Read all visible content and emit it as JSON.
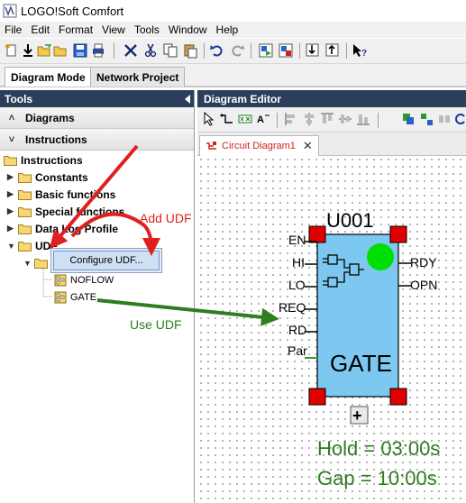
{
  "window": {
    "title": "LOGO!Soft Comfort",
    "app_icon": "logo-app-icon"
  },
  "menubar": {
    "items": [
      "File",
      "Edit",
      "Format",
      "View",
      "Tools",
      "Window",
      "Help"
    ]
  },
  "toolbar": {
    "icons": [
      "new-icon",
      "download-icon",
      "open-folder-icon",
      "open-file-icon",
      "save-icon",
      "print-icon",
      "cut-icon",
      "scissors-icon",
      "copy-icon",
      "paste-icon",
      "undo-icon",
      "redo-icon",
      "simulation-icon",
      "online-test-icon",
      "transfer-to-pc-icon",
      "transfer-to-logo-icon",
      "context-help-icon"
    ]
  },
  "mode_tabs": [
    "Diagram Mode",
    "Network Project"
  ],
  "tools": {
    "header": "Tools",
    "sections": [
      "Diagrams",
      "Instructions"
    ],
    "tree": {
      "root": "Instructions",
      "folders": [
        "Constants",
        "Basic functions",
        "Special functions",
        "Data Log Profile",
        "UDF"
      ],
      "udf_children": [
        "NOFLOW",
        "GATE"
      ]
    },
    "context_menu": {
      "item": "Configure UDF..."
    }
  },
  "editor": {
    "header": "Diagram Editor",
    "doc_tab": "Circuit Diagram1",
    "block": {
      "id": "U001",
      "name": "GATE",
      "inputs": [
        "EN",
        "HI",
        "LO",
        "REQ",
        "RD",
        "Par"
      ],
      "outputs": [
        "RDY",
        "OPN"
      ],
      "expand": "+",
      "fill_color": "#7cc8f0",
      "status_color": "#00e000",
      "corner_color": "#e00000"
    },
    "params": [
      "Hold = 03:00s",
      "Gap = 10:00s"
    ],
    "params_color": "#2e7d1f"
  },
  "annotations": {
    "add_udf": "Add UDF",
    "use_udf": "Use UDF",
    "add_color": "#e02020",
    "use_color": "#2e7d1f"
  }
}
